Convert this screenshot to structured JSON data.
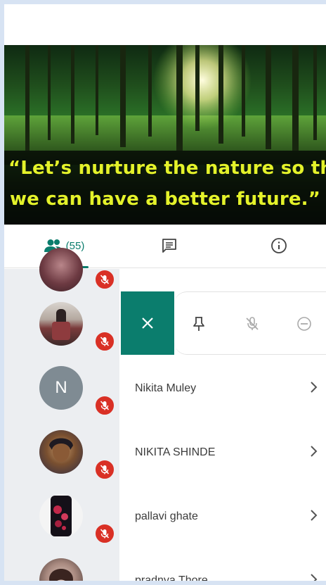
{
  "banner": {
    "quote_line1": "“Let’s nurture the nature so that",
    "quote_line2": "we can have a better future.”"
  },
  "tabs": {
    "people_count": "(55)",
    "items": [
      {
        "name": "people",
        "icon": "people-icon"
      },
      {
        "name": "chat",
        "icon": "chat-icon"
      },
      {
        "name": "info",
        "icon": "info-icon"
      }
    ]
  },
  "actions": {
    "close_icon": "close-icon",
    "pin_icon": "pin-icon",
    "mute_icon": "mic-off-icon",
    "remove_icon": "remove-icon"
  },
  "participants": [
    {
      "name": "Nikita Muley",
      "initial": "N"
    },
    {
      "name": "NIKITA SHINDE"
    },
    {
      "name": "pallavi ghate"
    },
    {
      "name": "pradnya Thore"
    }
  ],
  "colors": {
    "accent": "#0b7d6d",
    "mute_badge": "#d93025",
    "quote_text": "#e4f22a"
  }
}
